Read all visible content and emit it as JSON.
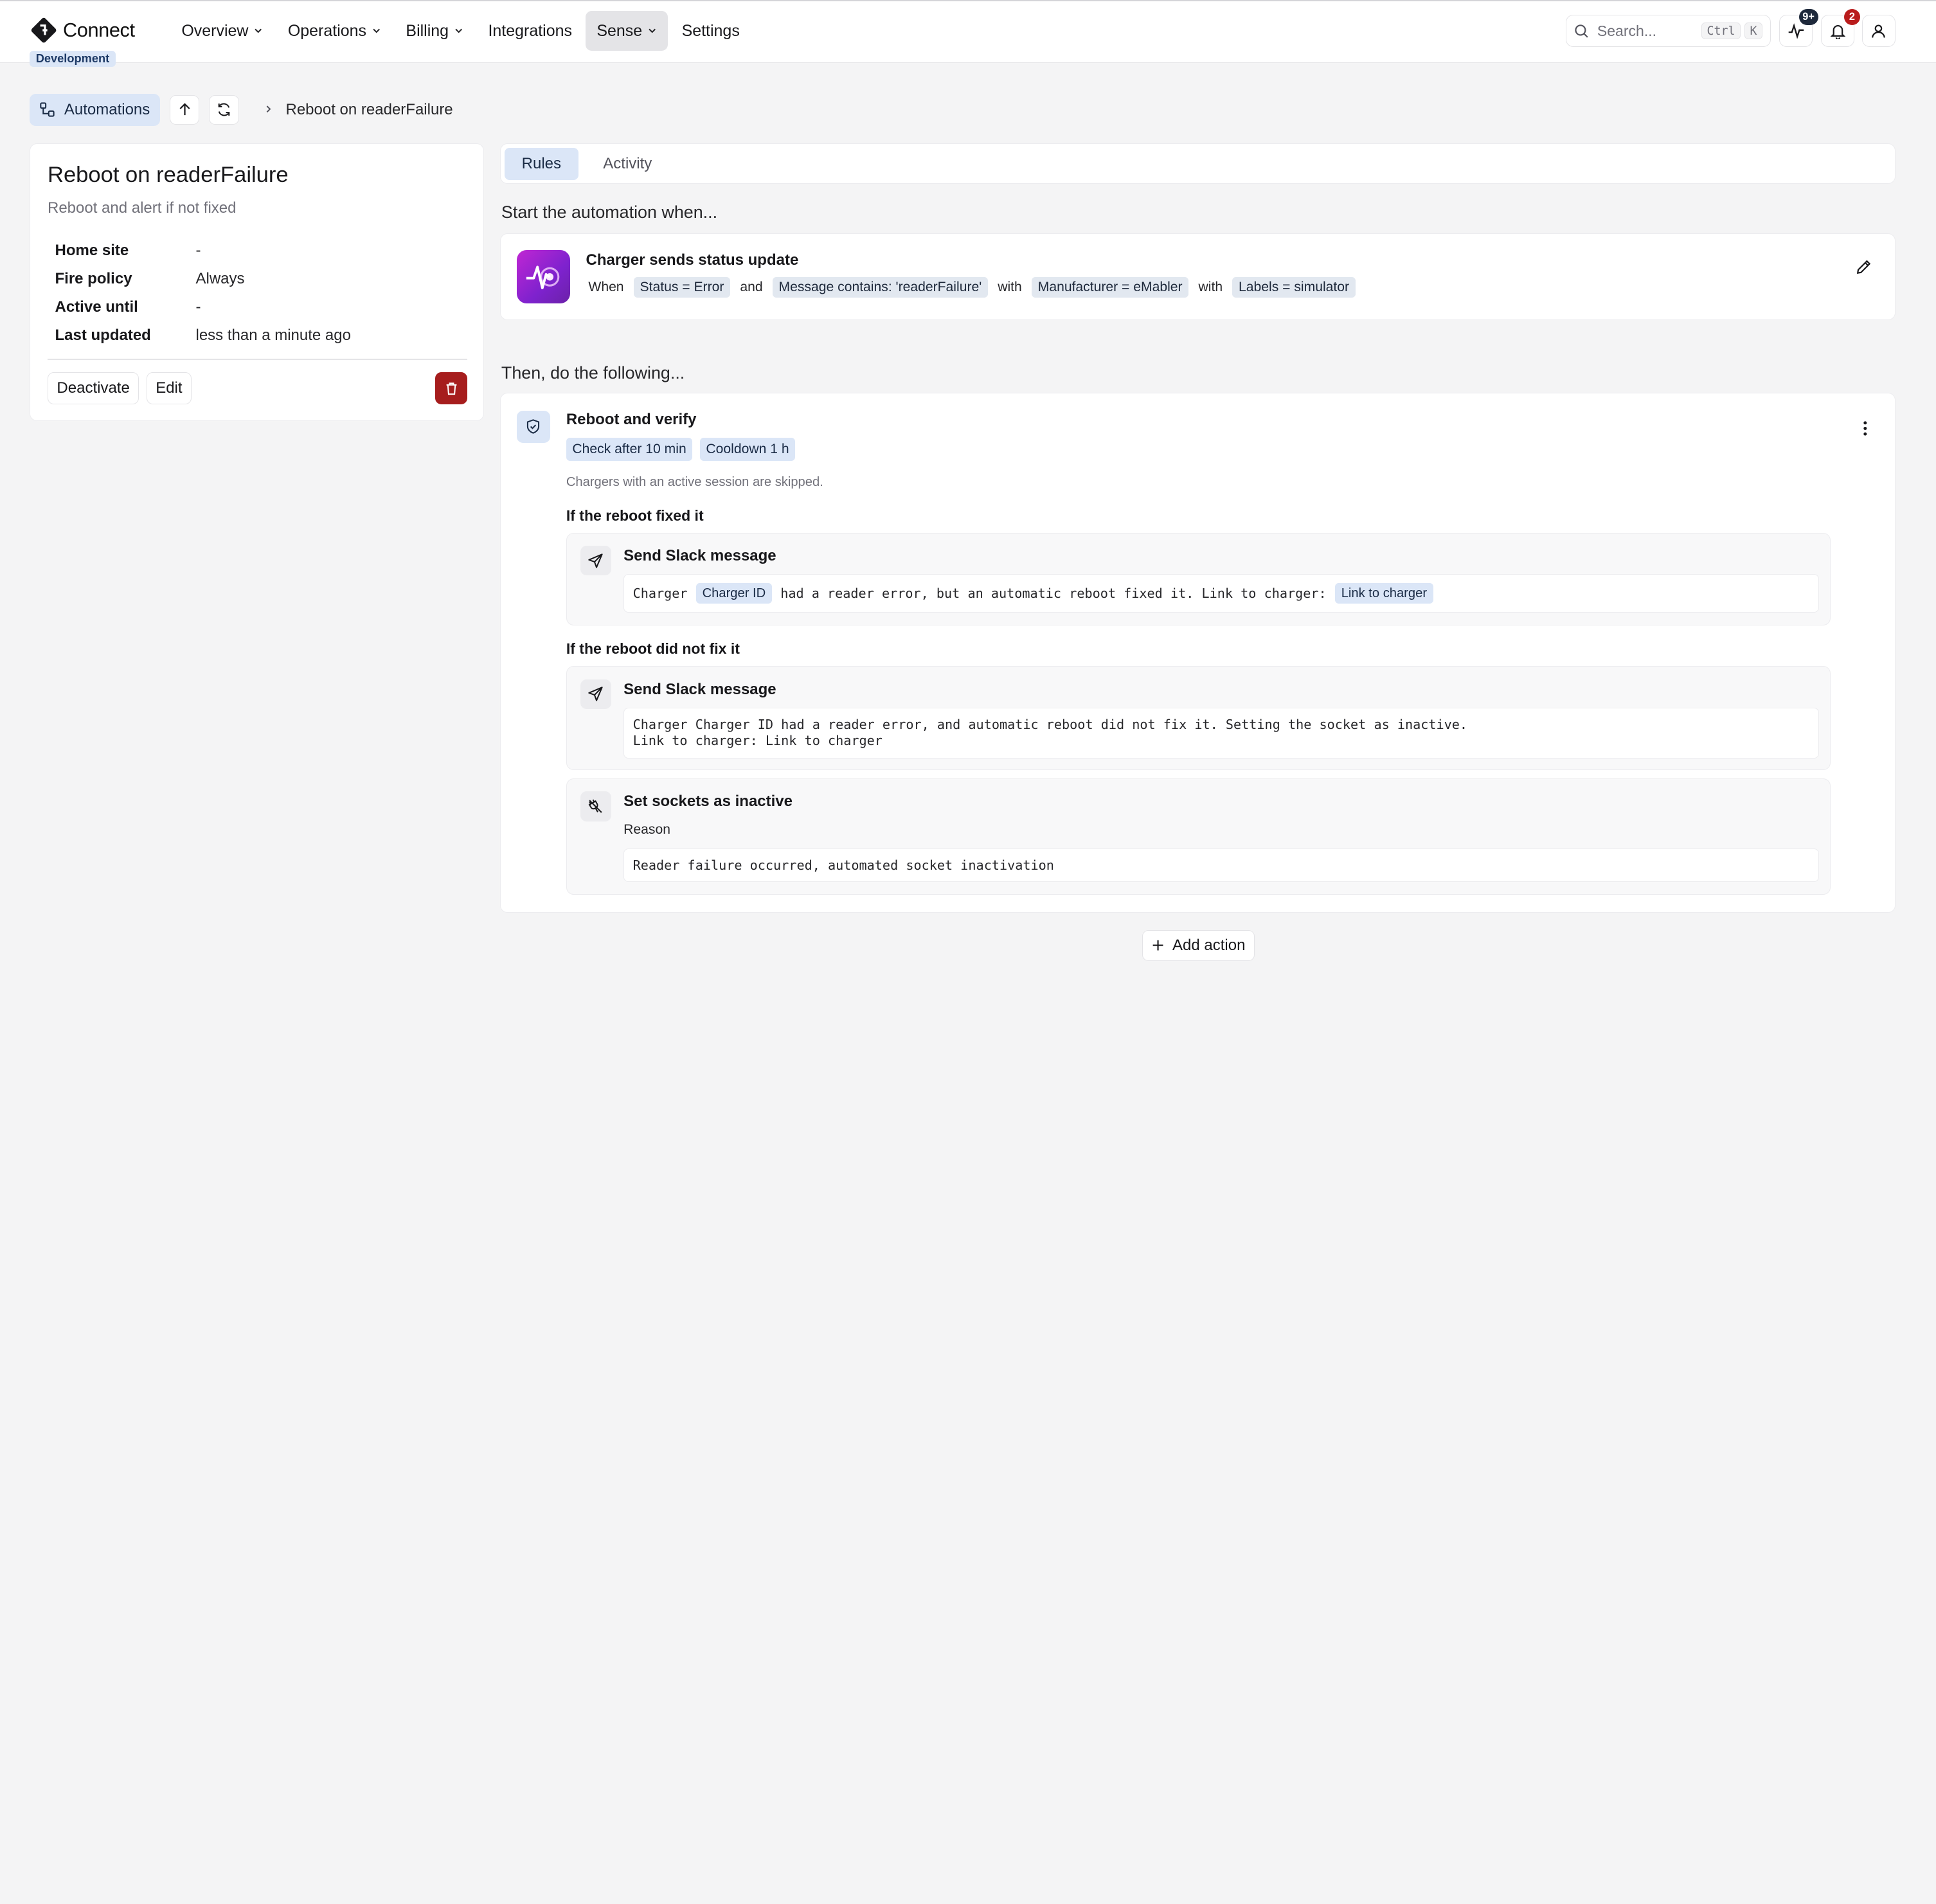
{
  "app": {
    "name": "Connect",
    "environment": "Development"
  },
  "nav": [
    {
      "label": "Overview",
      "has_menu": true
    },
    {
      "label": "Operations",
      "has_menu": true
    },
    {
      "label": "Billing",
      "has_menu": true
    },
    {
      "label": "Integrations",
      "has_menu": false
    },
    {
      "label": "Sense",
      "has_menu": true,
      "active": true
    },
    {
      "label": "Settings",
      "has_menu": false
    }
  ],
  "search": {
    "placeholder": "Search...",
    "shortcut": [
      "Ctrl",
      "K"
    ]
  },
  "header_icons": {
    "activity_badge": "9+",
    "notifications_badge": "2"
  },
  "breadcrumb": {
    "root": "Automations",
    "current": "Reboot on readerFailure"
  },
  "automation": {
    "title": "Reboot on readerFailure",
    "description": "Reboot and alert if not fixed",
    "details": [
      {
        "key": "Home site",
        "value": "-"
      },
      {
        "key": "Fire policy",
        "value": "Always"
      },
      {
        "key": "Active until",
        "value": "-"
      },
      {
        "key": "Last updated",
        "value": "less than a minute ago"
      }
    ],
    "deactivate_label": "Deactivate",
    "edit_label": "Edit"
  },
  "tabs": [
    {
      "label": "Rules",
      "active": true
    },
    {
      "label": "Activity",
      "active": false
    }
  ],
  "trigger": {
    "heading": "Start the automation when...",
    "title": "Charger sends status update",
    "when": "When",
    "and": "and",
    "with1": "with",
    "with2": "with",
    "conditions": [
      "Status = Error",
      "Message contains: 'readerFailure'",
      "Manufacturer = eMabler",
      "Labels = simulator"
    ]
  },
  "actions": {
    "heading": "Then, do the following...",
    "title": "Reboot and verify",
    "chips": [
      "Check after 10 min",
      "Cooldown 1 h"
    ],
    "note": "Chargers with an active session are skipped.",
    "fixed_heading": "If the reboot fixed it",
    "fixed_step": {
      "title": "Send Slack message",
      "msg_a": "Charger",
      "chip_a": "Charger ID",
      "msg_b": "had a reader error, but an automatic reboot fixed it. Link to charger:",
      "chip_b": "Link to charger"
    },
    "not_fixed_heading": "If the reboot did not fix it",
    "not_fixed_step": {
      "title": "Send Slack message",
      "line1": "Charger Charger ID had a reader error, and automatic reboot did not fix it. Setting the socket as inactive.",
      "line2": "Link to charger: Link to charger"
    },
    "inactive_step": {
      "title": "Set sockets as inactive",
      "reason_label": "Reason",
      "reason": "Reader failure occurred, automated socket inactivation"
    }
  },
  "add_action_label": "Add action"
}
